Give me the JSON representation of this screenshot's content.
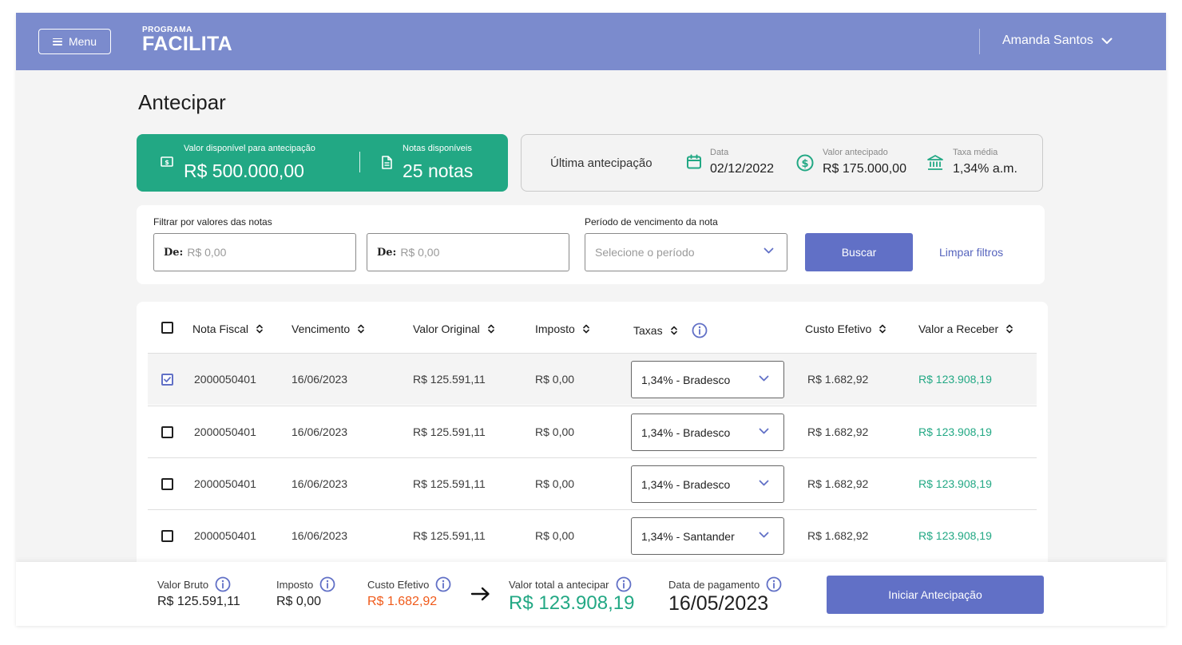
{
  "header": {
    "menu_label": "Menu",
    "logo_small": "PROGRAMA",
    "logo_big": "FACILITA",
    "user_name": "Amanda Santos"
  },
  "page": {
    "title": "Antecipar"
  },
  "available": {
    "value_label": "Valor disponível para antecipação",
    "value": "R$ 500.000,00",
    "notes_label": "Notas disponíveis",
    "notes": "25 notas"
  },
  "last": {
    "title": "Última antecipação",
    "date_label": "Data",
    "date": "02/12/2022",
    "amount_label": "Valor antecipado",
    "amount": "R$ 175.000,00",
    "rate_label": "Taxa média",
    "rate": "1,34% a.m."
  },
  "filters": {
    "values_label": "Filtrar por valores das notas",
    "from1_prefix": "De:",
    "from1_placeholder": "R$ 0,00",
    "from2_prefix": "De:",
    "from2_placeholder": "R$ 0,00",
    "period_label": "Período de vencimento da nota",
    "period_placeholder": "Selecione o período",
    "search_label": "Buscar",
    "clear_label": "Limpar filtros"
  },
  "table": {
    "columns": [
      "Nota Fiscal",
      "Vencimento",
      "Valor Original",
      "Imposto",
      "Taxas",
      "Custo Efetivo",
      "Valor a Receber"
    ],
    "rows": [
      {
        "checked": true,
        "nota": "2000050401",
        "venc": "16/06/2023",
        "original": "R$ 125.591,11",
        "imposto": "R$ 0,00",
        "taxa": "1,34% - Bradesco",
        "custo": "R$ 1.682,92",
        "receber": "R$ 123.908,19"
      },
      {
        "checked": false,
        "nota": "2000050401",
        "venc": "16/06/2023",
        "original": "R$ 125.591,11",
        "imposto": "R$ 0,00",
        "taxa": "1,34% - Bradesco",
        "custo": "R$ 1.682,92",
        "receber": "R$ 123.908,19"
      },
      {
        "checked": false,
        "nota": "2000050401",
        "venc": "16/06/2023",
        "original": "R$ 125.591,11",
        "imposto": "R$ 0,00",
        "taxa": "1,34% - Bradesco",
        "custo": "R$ 1.682,92",
        "receber": "R$ 123.908,19"
      },
      {
        "checked": false,
        "nota": "2000050401",
        "venc": "16/06/2023",
        "original": "R$ 125.591,11",
        "imposto": "R$ 0,00",
        "taxa": "1,34% - Santander",
        "custo": "R$ 1.682,92",
        "receber": "R$ 123.908,19"
      }
    ]
  },
  "summary": {
    "gross_label": "Valor Bruto",
    "gross": "R$ 125.591,11",
    "tax_label": "Imposto",
    "tax": "R$ 0,00",
    "cost_label": "Custo Efetivo",
    "cost": "R$ 1.682,92",
    "total_label": "Valor total a antecipar",
    "total": "R$ 123.908,19",
    "pay_date_label": "Data de pagamento",
    "pay_date": "16/05/2023",
    "start_label": "Iniciar Antecipação"
  },
  "colors": {
    "header": "#7b8bcd",
    "accent": "#6170c6",
    "green": "#22a884",
    "orange": "#f05a1a"
  }
}
